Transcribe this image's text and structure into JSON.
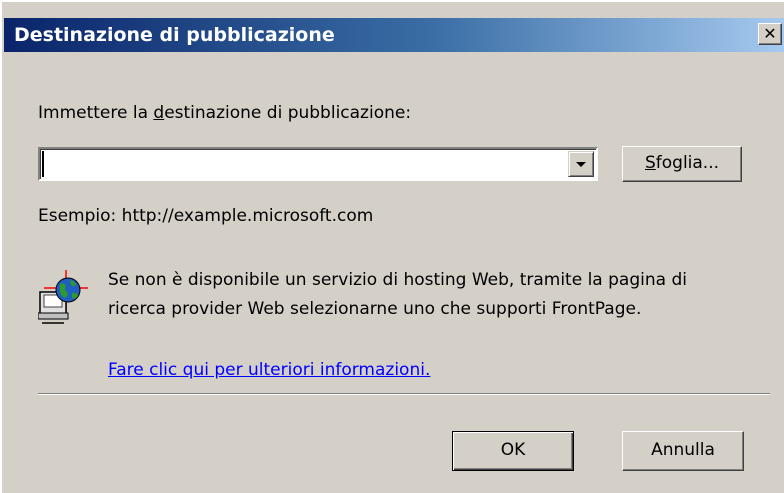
{
  "dialog": {
    "title": "Destinazione di pubblicazione",
    "close_label": "✕"
  },
  "form": {
    "prompt_before": "Immettere la ",
    "prompt_accel": "d",
    "prompt_after": "estinazione di pubblicazione:",
    "destination_value": "",
    "browse_accel": "S",
    "browse_rest": "foglia...",
    "example_text": "Esempio: http://example.microsoft.com"
  },
  "info": {
    "line1": "Se non è disponibile un servizio di hosting Web, tramite la pagina di",
    "line2": "ricerca provider Web selezionarne uno che supporti FrontPage.",
    "link_text": "Fare clic qui per ulteriori informazioni.",
    "icon": "web-globe-icon"
  },
  "buttons": {
    "ok_label": "OK",
    "cancel_label": "Annulla"
  },
  "colors": {
    "title_start": "#0a246a",
    "title_end": "#a6caf0",
    "dialog_bg": "#d4d0c8",
    "link": "#0000ff"
  }
}
